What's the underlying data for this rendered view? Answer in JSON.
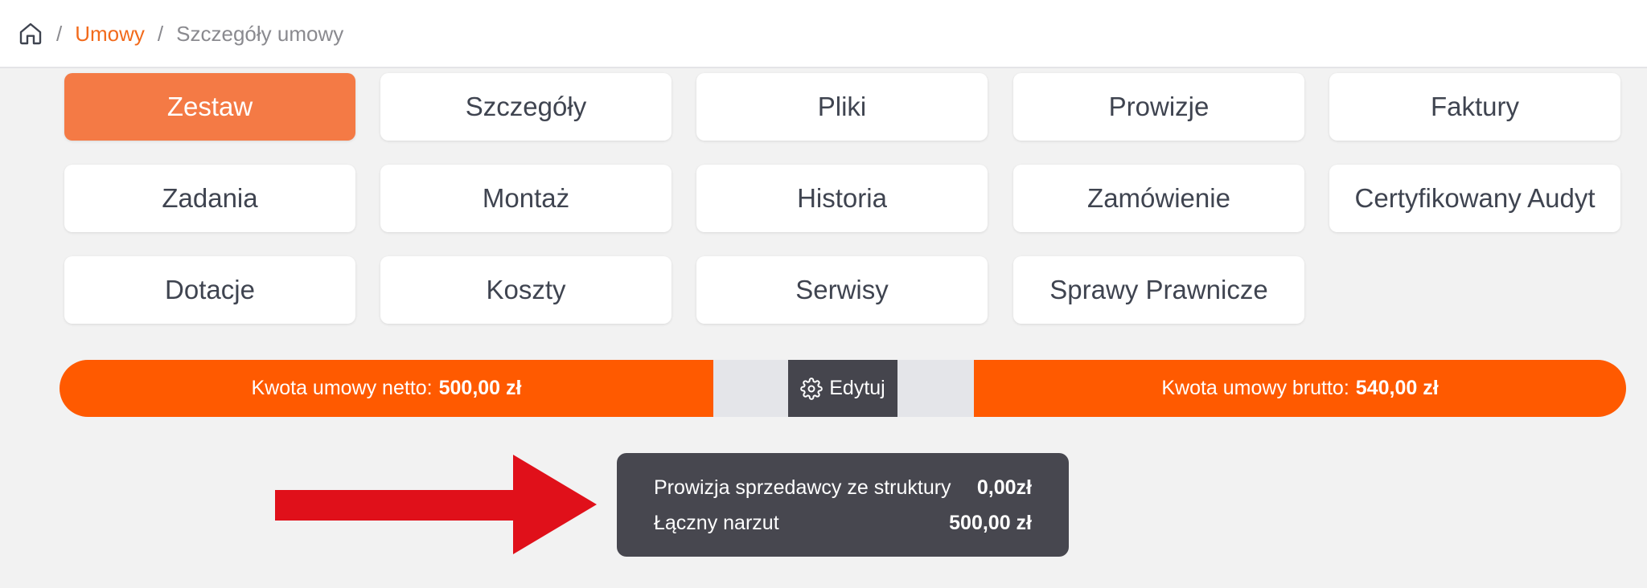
{
  "breadcrumb": {
    "home_icon": "home-icon",
    "separator": "/",
    "items": [
      "Umowy",
      "Szczegóły umowy"
    ]
  },
  "tabs": [
    {
      "label": "Zestaw",
      "active": true
    },
    {
      "label": "Szczegóły"
    },
    {
      "label": "Pliki"
    },
    {
      "label": "Prowizje"
    },
    {
      "label": "Faktury"
    },
    {
      "label": "Zadania"
    },
    {
      "label": "Montaż"
    },
    {
      "label": "Historia"
    },
    {
      "label": "Zamówienie"
    },
    {
      "label": "Certyfikowany Audyt"
    },
    {
      "label": "Dotacje"
    },
    {
      "label": "Koszty"
    },
    {
      "label": "Serwisy"
    },
    {
      "label": "Sprawy Prawnicze"
    }
  ],
  "amounts": {
    "net_label": "Kwota umowy netto:",
    "net_value": "500,00 zł",
    "gross_label": "Kwota umowy brutto:",
    "gross_value": "540,00 zł",
    "edit_label": "Edytuj",
    "edit_icon": "gear-icon"
  },
  "tooltip": {
    "rows": [
      {
        "label": "Prowizja sprzedawcy ze struktury",
        "value": "0,00zł"
      },
      {
        "label": "Łączny narzut",
        "value": "500,00 zł"
      }
    ]
  },
  "colors": {
    "accent": "#ff5a00",
    "active_tab": "#f47a45",
    "link": "#f26a1b",
    "annotation_arrow": "#e0101a",
    "tooltip_bg": "#47474f"
  }
}
